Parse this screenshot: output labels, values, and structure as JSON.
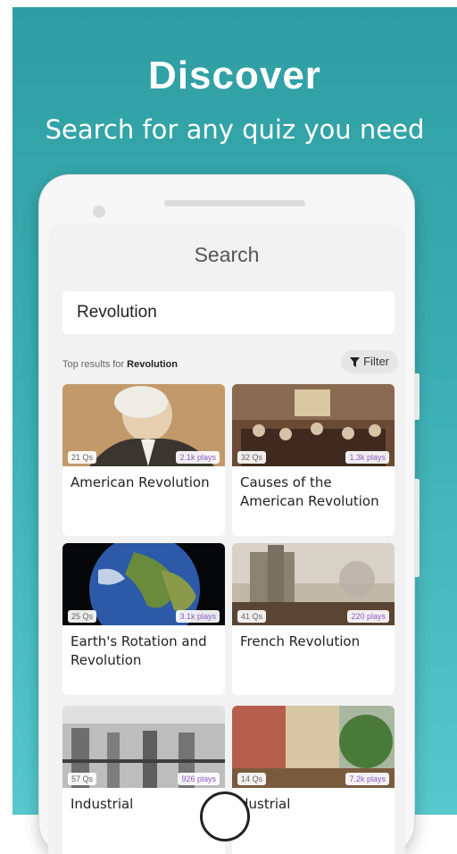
{
  "header": {
    "title": "Discover",
    "subtitle": "Search for any quiz you need"
  },
  "screen": {
    "title": "Search",
    "search_value": "Revolution",
    "results_prefix": "Top results for ",
    "results_query": "Revolution",
    "filter_label": "Filter"
  },
  "cards": [
    {
      "title": "American Revolution",
      "questions": "21 Qs",
      "plays": "2.1k plays"
    },
    {
      "title": "Causes of the American Revolution",
      "questions": "32 Qs",
      "plays": "1.3k plays"
    },
    {
      "title": "Earth's Rotation and Revolution",
      "questions": "25 Qs",
      "plays": "3.1k plays"
    },
    {
      "title": "French Revolution",
      "questions": "41 Qs",
      "plays": "220 plays"
    },
    {
      "title": "Industrial",
      "questions": "57 Qs",
      "plays": "926 plays"
    },
    {
      "title": "dustrial",
      "questions": "14 Qs",
      "plays": "7.2k plays"
    }
  ],
  "colors": {
    "background_top": "#2f9ea2",
    "background_bottom": "#56c8cc",
    "plays_text": "#8a5cc7"
  }
}
